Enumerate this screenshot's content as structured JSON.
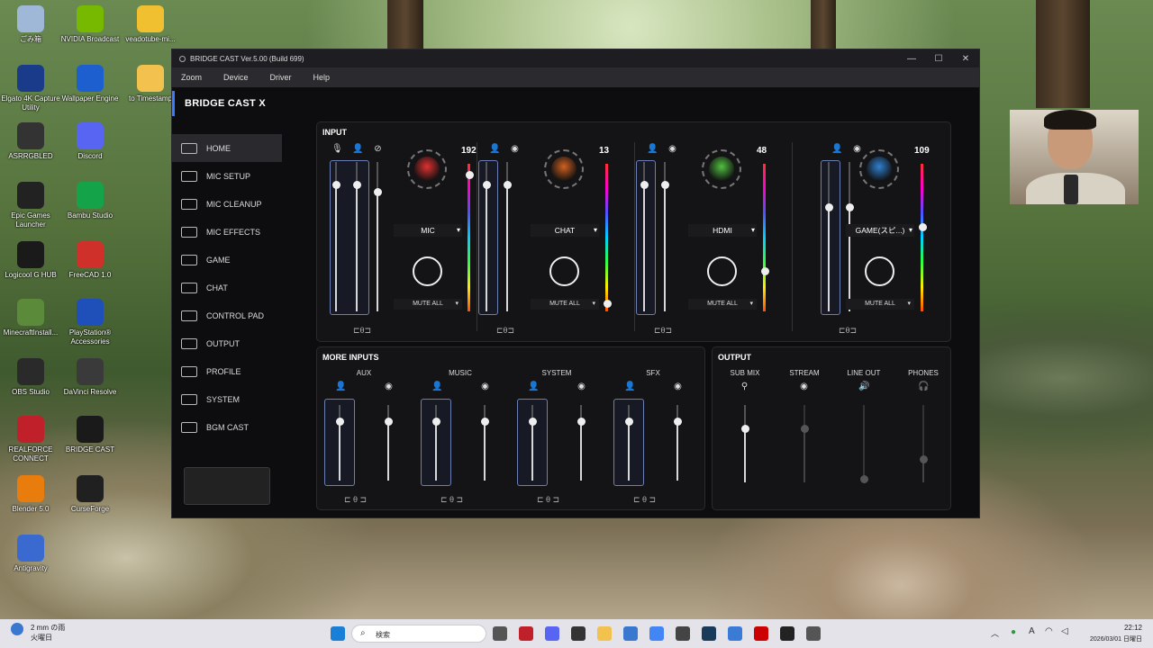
{
  "desktop": {
    "icons": [
      {
        "label": "ごみ箱",
        "color": "#9fb8d8"
      },
      {
        "label": "NVIDIA Broadcast",
        "color": "#76b900"
      },
      {
        "label": "veadotube-mi...",
        "color": "#f0c030"
      },
      {
        "label": "Elgato 4K Capture Utility",
        "color": "#1a3a8a"
      },
      {
        "label": "Wallpaper Engine",
        "color": "#1e5fd0"
      },
      {
        "label": "to Timestamp",
        "color": "#f2c14e"
      },
      {
        "label": "ASRRGBLED",
        "color": "#333333"
      },
      {
        "label": "Discord",
        "color": "#5865f2"
      },
      {
        "label": "Epic Games Launcher",
        "color": "#222222"
      },
      {
        "label": "Bambu Studio",
        "color": "#15a34a"
      },
      {
        "label": "Logicool G HUB",
        "color": "#1a1a1a"
      },
      {
        "label": "FreeCAD 1.0",
        "color": "#d0302a"
      },
      {
        "label": "MinecraftInstall...",
        "color": "#5a8a3a"
      },
      {
        "label": "PlayStation® Accessories",
        "color": "#1f4fb8"
      },
      {
        "label": "OBS Studio",
        "color": "#2a2a2a"
      },
      {
        "label": "DaVinci Resolve",
        "color": "#3a3a3a"
      },
      {
        "label": "REALFORCE CONNECT",
        "color": "#c0202a"
      },
      {
        "label": "BRIDGE CAST",
        "color": "#1a1a1a"
      },
      {
        "label": "Blender 5.0",
        "color": "#e87d0d"
      },
      {
        "label": "CurseForge",
        "color": "#202020"
      },
      {
        "label": "Antigravity",
        "color": "#3a6ad0"
      }
    ]
  },
  "window": {
    "title": "BRIDGE CAST Ver.5.00 (Build 699)",
    "controls": {
      "minimize": "—",
      "maximize": "☐",
      "close": "✕"
    },
    "menu": [
      "Zoom",
      "Device",
      "Driver",
      "Help"
    ],
    "brand": "BRIDGE CAST X",
    "nav": [
      {
        "label": "HOME",
        "icon": "home-icon",
        "active": true
      },
      {
        "label": "MIC SETUP",
        "icon": "mic-setup-icon"
      },
      {
        "label": "MIC CLEANUP",
        "icon": "mic-cleanup-icon"
      },
      {
        "label": "MIC EFFECTS",
        "icon": "mic-effects-icon"
      },
      {
        "label": "GAME",
        "icon": "gamepad-icon"
      },
      {
        "label": "CHAT",
        "icon": "chat-icon"
      },
      {
        "label": "CONTROL PAD",
        "icon": "grid-icon"
      },
      {
        "label": "OUTPUT",
        "icon": "speaker-icon"
      },
      {
        "label": "PROFILE",
        "icon": "profile-icon"
      },
      {
        "label": "SYSTEM",
        "icon": "settings-icon"
      },
      {
        "label": "BGM CAST",
        "icon": "music-icon"
      }
    ]
  },
  "input": {
    "title": "INPUT",
    "channels": [
      {
        "name": "MIC",
        "level": "192",
        "knob_color": "#e03030",
        "mute": "MUTE ALL",
        "fader1": 0.85,
        "fader2": 0.85,
        "meter": 0.95
      },
      {
        "name": "CHAT",
        "level": "13",
        "knob_color": "#d06020",
        "mute": "MUTE ALL",
        "fader1": 0.85,
        "fader2": 0.85,
        "meter": 0.08
      },
      {
        "name": "HDMI",
        "level": "48",
        "knob_color": "#50c040",
        "mute": "MUTE ALL",
        "fader1": 0.85,
        "fader2": 0.85,
        "meter": 0.3
      },
      {
        "name": "GAME(スピ...)",
        "level": "109",
        "knob_color": "#3080d0",
        "mute": "MUTE ALL",
        "fader1": 0.7,
        "fader2": 0.7,
        "meter": 0.6
      }
    ]
  },
  "more_inputs": {
    "title": "MORE INPUTS",
    "channels": [
      {
        "name": "AUX"
      },
      {
        "name": "MUSIC"
      },
      {
        "name": "SYSTEM"
      },
      {
        "name": "SFX"
      }
    ]
  },
  "output": {
    "title": "OUTPUT",
    "channels": [
      {
        "name": "SUB MIX",
        "level": 0.7
      },
      {
        "name": "STREAM",
        "level": 0.7
      },
      {
        "name": "LINE OUT",
        "level": 0.05
      },
      {
        "name": "PHONES",
        "level": 0.3
      }
    ]
  },
  "taskbar": {
    "weather": "2 mm の雨",
    "day": "火曜日",
    "search": "検索",
    "time": "22:12",
    "date": "2026/03/01 日曜日",
    "ime": "A"
  }
}
